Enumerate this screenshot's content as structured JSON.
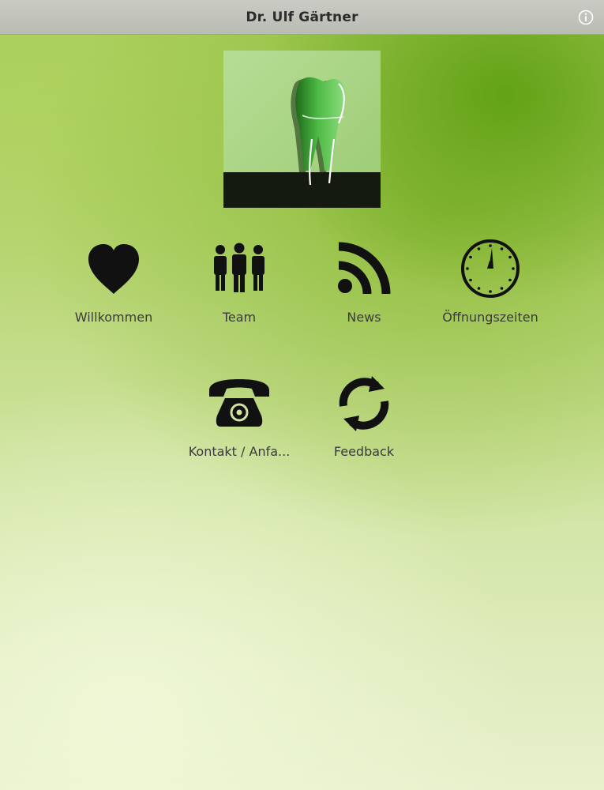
{
  "header": {
    "title": "Dr. Ulf Gärtner",
    "info_icon": "info-icon"
  },
  "logo": {
    "icon": "tooth-logo-icon",
    "colors": {
      "tooth": "#3fae3a",
      "bar": "#151a10",
      "background": "#a9d483"
    }
  },
  "menu": {
    "items": [
      {
        "label": "Willkommen",
        "icon": "heart-icon"
      },
      {
        "label": "Team",
        "icon": "team-icon"
      },
      {
        "label": "News",
        "icon": "rss-icon"
      },
      {
        "label": "Öffnungszeiten",
        "icon": "clock-icon"
      },
      {
        "label": "Kontakt / Anfa...",
        "icon": "phone-icon"
      },
      {
        "label": "Feedback",
        "icon": "refresh-icon"
      }
    ]
  },
  "colors": {
    "accent_green": "#7fb52a",
    "icon": "#111111",
    "label": "#3a3a3a"
  }
}
